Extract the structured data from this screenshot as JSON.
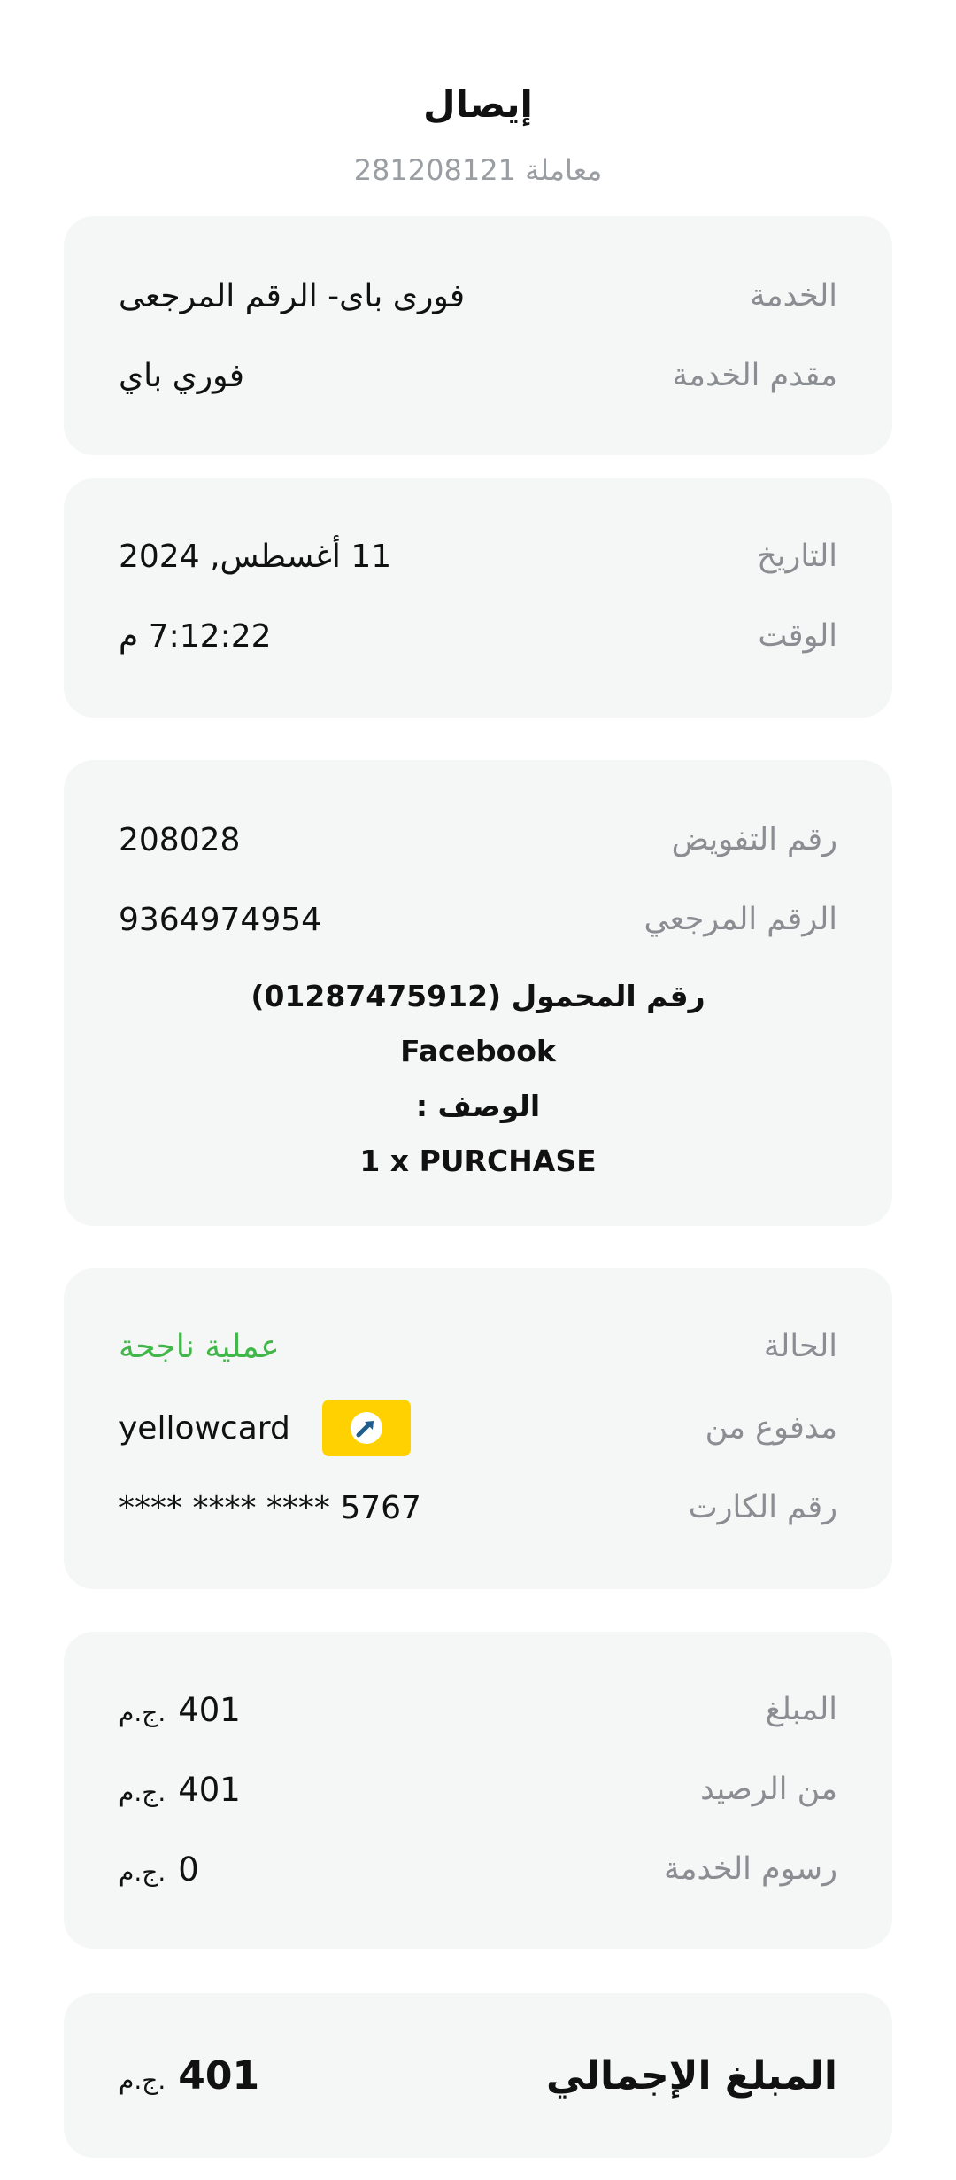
{
  "header": {
    "title": "إيصال",
    "subtitle": "معاملة 281208121"
  },
  "service_card": {
    "service_label": "الخدمة",
    "service_value": "فورى باى- الرقم المرجعى",
    "provider_label": "مقدم الخدمة",
    "provider_value": "فوري باي"
  },
  "datetime_card": {
    "date_label": "التاريخ",
    "date_value": "11 أغسطس, 2024",
    "time_label": "الوقت",
    "time_value": "7:12:22 م"
  },
  "reference_card": {
    "auth_label": "رقم التفويض",
    "auth_value": "208028",
    "ref_label": "الرقم المرجعي",
    "ref_value": "9364974954",
    "mobile_line": "رقم المحمول (01287475912)",
    "merchant_line": "Facebook",
    "description_line": "الوصف :",
    "purchase_line": "1 x PURCHASE"
  },
  "payment_card": {
    "status_label": "الحالة",
    "status_value": "عملية ناجحة",
    "paid_from_label": "مدفوع من",
    "paid_from_value": "yellowcard",
    "paid_from_icon": "yellowcard-logo-icon",
    "card_label": "رقم الكارت",
    "card_value": "**** **** **** 5767"
  },
  "amount_card": {
    "amount_label": "المبلغ",
    "amount_value": "401",
    "balance_label": "من الرصيد",
    "balance_value": "401",
    "fees_label": "رسوم الخدمة",
    "fees_value": "0",
    "currency": "ج.م."
  },
  "total_card": {
    "total_label": "المبلغ الإجمالي",
    "total_value": "401",
    "currency": "ج.م."
  },
  "colors": {
    "success": "#41b649",
    "card_background": "#f5f6f6",
    "label_gray": "#8a8e92",
    "yellowcard_brand": "#ffd100"
  }
}
